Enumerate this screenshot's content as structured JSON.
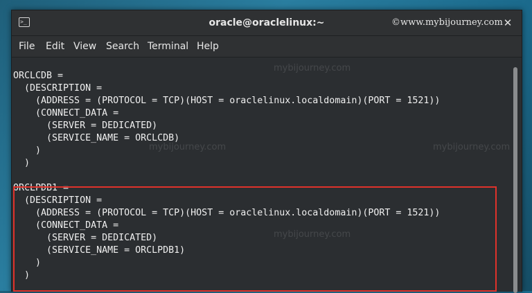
{
  "window": {
    "title": "oracle@oraclelinux:~",
    "watermark": "©www.mybijourney.com",
    "background_watermark": "mybijourney.com"
  },
  "menu": [
    "File",
    "Edit",
    "View",
    "Search",
    "Terminal",
    "Help"
  ],
  "terminal_lines": [
    "",
    "ORCLCDB =",
    "  (DESCRIPTION =",
    "    (ADDRESS = (PROTOCOL = TCP)(HOST = oraclelinux.localdomain)(PORT = 1521))",
    "    (CONNECT_DATA =",
    "      (SERVER = DEDICATED)",
    "      (SERVICE_NAME = ORCLCDB)",
    "    )",
    "  )",
    "",
    "ORCLPDB1 =",
    "  (DESCRIPTION =",
    "    (ADDRESS = (PROTOCOL = TCP)(HOST = oraclelinux.localdomain)(PORT = 1521))",
    "    (CONNECT_DATA =",
    "      (SERVER = DEDICATED)",
    "      (SERVICE_NAME = ORCLPDB1)",
    "    )",
    "  )"
  ],
  "colors": {
    "highlight": "#e0322b",
    "terminal_bg": "#2b2e31",
    "text": "#f0f0f0"
  },
  "icons": {
    "window_icon": "terminal-icon",
    "close": "close-icon"
  }
}
